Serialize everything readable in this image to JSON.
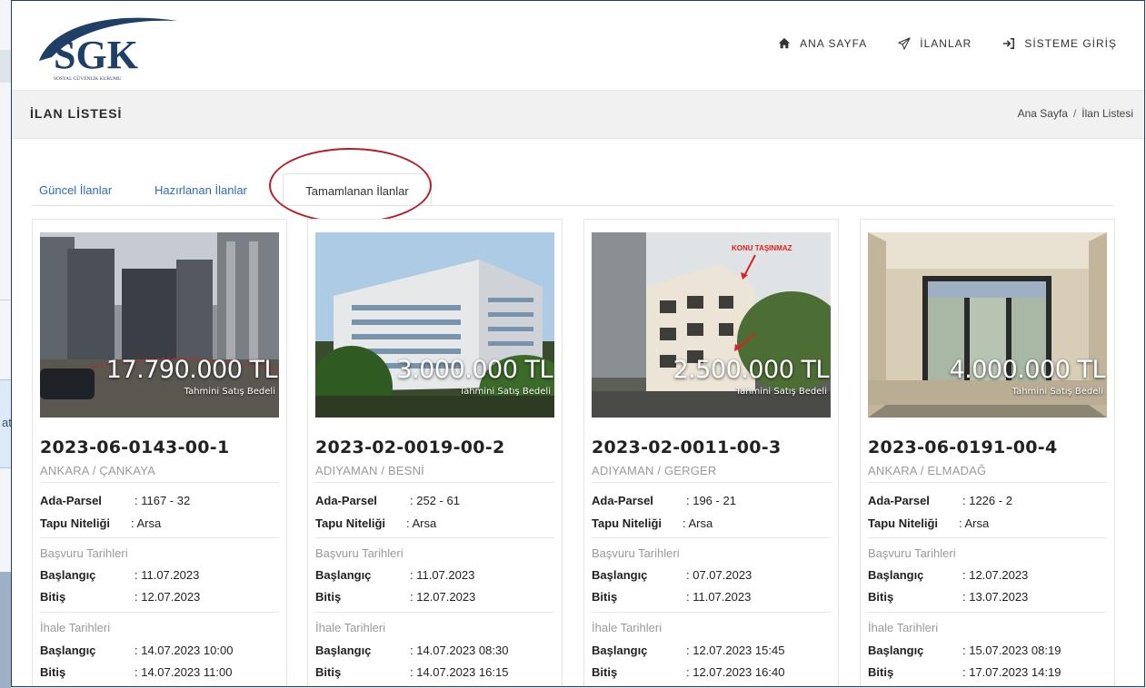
{
  "background": {
    "fragment": "ate"
  },
  "header": {
    "logo_text": "SGK",
    "logo_subtext": "SOSYAL GÜVENLİK KURUMU",
    "nav": [
      {
        "label": "ANA SAYFA",
        "icon": "home-icon"
      },
      {
        "label": "İLANLAR",
        "icon": "paper-plane-icon"
      },
      {
        "label": "SİSTEME GİRİŞ",
        "icon": "sign-in-icon"
      }
    ]
  },
  "titlebar": {
    "title": "İLAN LİSTESİ",
    "breadcrumb": [
      "Ana Sayfa",
      "İlan Listesi"
    ],
    "separator": "/"
  },
  "tabs": [
    {
      "label": "Güncel İlanlar",
      "active": false
    },
    {
      "label": "Hazırlanan İlanlar",
      "active": false
    },
    {
      "label": "Tamamlanan İlanlar",
      "active": true
    }
  ],
  "colors": {
    "brand": "#1f3f66",
    "link": "#2f6db1",
    "highlight": "#b4202a"
  },
  "card_labels": {
    "ada_parsel": "Ada-Parsel",
    "tapu": "Tapu Niteliği",
    "basvuru": "Başvuru Tarihleri",
    "ihale": "İhale Tarihleri",
    "baslangic": "Başlangıç",
    "bitis": "Bitiş",
    "price_sub": "Tahmini Satış Bedeli"
  },
  "cards": [
    {
      "price": "17.790.000 TL",
      "id": "2023-06-0143-00-1",
      "location": "ANKARA / ÇANKAYA",
      "ada_parsel": ": 1167 - 32",
      "tapu": ": Arsa",
      "basvuru_start": ": 11.07.2023",
      "basvuru_end": ": 12.07.2023",
      "ihale_start": ": 14.07.2023 10:00",
      "ihale_end": ": 14.07.2023 11:00",
      "photo_annotation": ""
    },
    {
      "price": "3.000.000 TL",
      "id": "2023-02-0019-00-2",
      "location": "ADIYAMAN / BESNİ",
      "ada_parsel": ": 252 - 61",
      "tapu": ": Arsa",
      "basvuru_start": ": 11.07.2023",
      "basvuru_end": ": 12.07.2023",
      "ihale_start": ": 14.07.2023 08:30",
      "ihale_end": ": 14.07.2023 16:15",
      "photo_annotation": ""
    },
    {
      "price": "2.500.000 TL",
      "id": "2023-02-0011-00-3",
      "location": "ADIYAMAN / GERGER",
      "ada_parsel": ": 196 - 21",
      "tapu": ": Arsa",
      "basvuru_start": ": 07.07.2023",
      "basvuru_end": ": 11.07.2023",
      "ihale_start": ": 12.07.2023 15:45",
      "ihale_end": ": 12.07.2023 16:40",
      "photo_annotation": "KONU TAŞINMAZ"
    },
    {
      "price": "4.000.000 TL",
      "id": "2023-06-0191-00-4",
      "location": "ANKARA / ELMADAĞ",
      "ada_parsel": ": 1226 - 2",
      "tapu": ": Arsa",
      "basvuru_start": ": 12.07.2023",
      "basvuru_end": ": 13.07.2023",
      "ihale_start": ": 15.07.2023 08:19",
      "ihale_end": ": 17.07.2023 14:19",
      "photo_annotation": ""
    }
  ]
}
